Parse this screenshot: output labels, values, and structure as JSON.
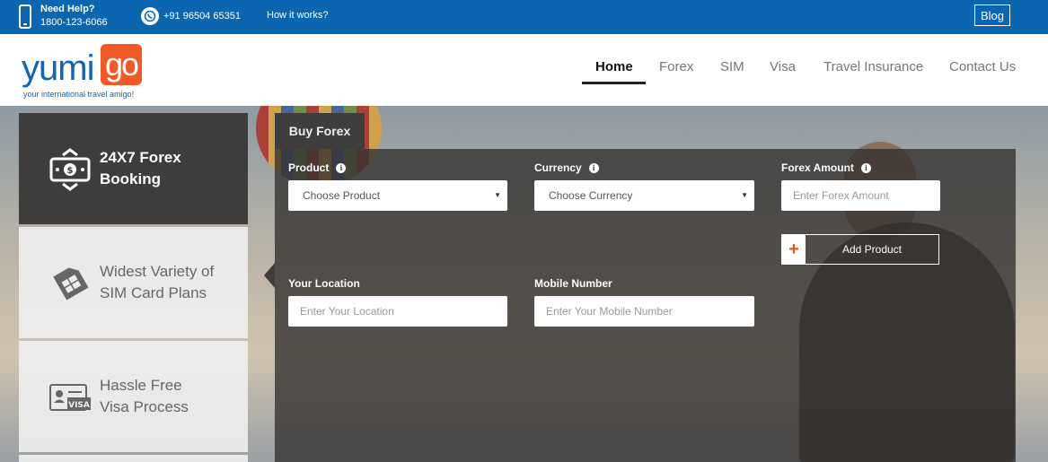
{
  "topbar": {
    "help_label": "Need Help?",
    "help_phone": "1800-123-6066",
    "whatsapp": "+91 96504 65351",
    "how_it_works": "How it works?",
    "blog": "Blog",
    "background_color": "#0a66b0"
  },
  "header": {
    "logo": {
      "word": "yumi",
      "go": "go",
      "tagline": "your international travel amigo!"
    },
    "nav": [
      {
        "label": "Home",
        "active": true
      },
      {
        "label": "Forex",
        "active": false
      },
      {
        "label": "SIM",
        "active": false
      },
      {
        "label": "Visa",
        "active": false
      },
      {
        "label": "Travel Insurance",
        "active": false
      },
      {
        "label": "Contact Us",
        "active": false
      }
    ]
  },
  "features": [
    {
      "line1": "24X7 Forex",
      "line2": "Booking",
      "icon": "money-icon",
      "active": true
    },
    {
      "line1": "Widest Variety of",
      "line2": "SIM Card Plans",
      "icon": "sim-card-icon",
      "active": false
    },
    {
      "line1": "Hassle Free",
      "line2": "Visa Process",
      "icon": "visa-card-icon",
      "active": false
    }
  ],
  "form": {
    "tab": "Buy Forex",
    "product": {
      "label": "Product",
      "value": "Choose Product"
    },
    "currency": {
      "label": "Currency",
      "value": "Choose Currency"
    },
    "forex_amount": {
      "label": "Forex Amount",
      "placeholder": "Enter Forex Amount"
    },
    "add_product": "Add Product",
    "location": {
      "label": "Your Location",
      "placeholder": "Enter Your Location"
    },
    "mobile": {
      "label": "Mobile Number",
      "placeholder": "Enter Your Mobile Number"
    },
    "info_glyph": "i",
    "caret_glyph": "▼",
    "plus_glyph": "+"
  },
  "colors": {
    "brand_blue": "#1565b0",
    "brand_orange": "#f05a28",
    "panel_dark": "#3f3d3b"
  }
}
